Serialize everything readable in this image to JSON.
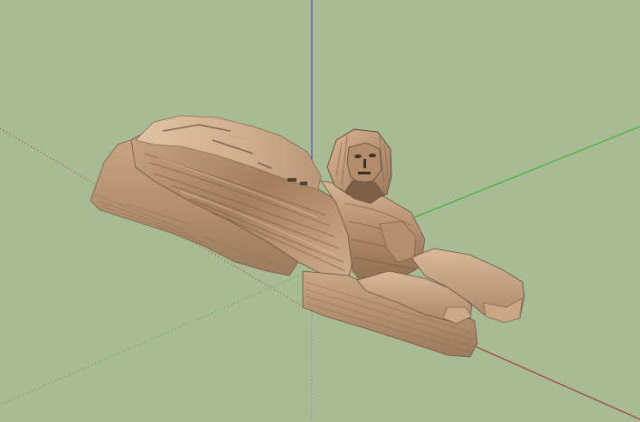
{
  "viewport": {
    "background_color": "#a9bb95",
    "axis_colors": {
      "red": "#9a2a2a",
      "green": "#2bb02b",
      "blue": "#3a3ad0"
    }
  },
  "model": {
    "subject": "sphinx",
    "stone_light": "#d2b08f",
    "stone_mid": "#b48f6c",
    "stone_dark": "#7e6048",
    "stone_shadow": "#5b4433"
  }
}
